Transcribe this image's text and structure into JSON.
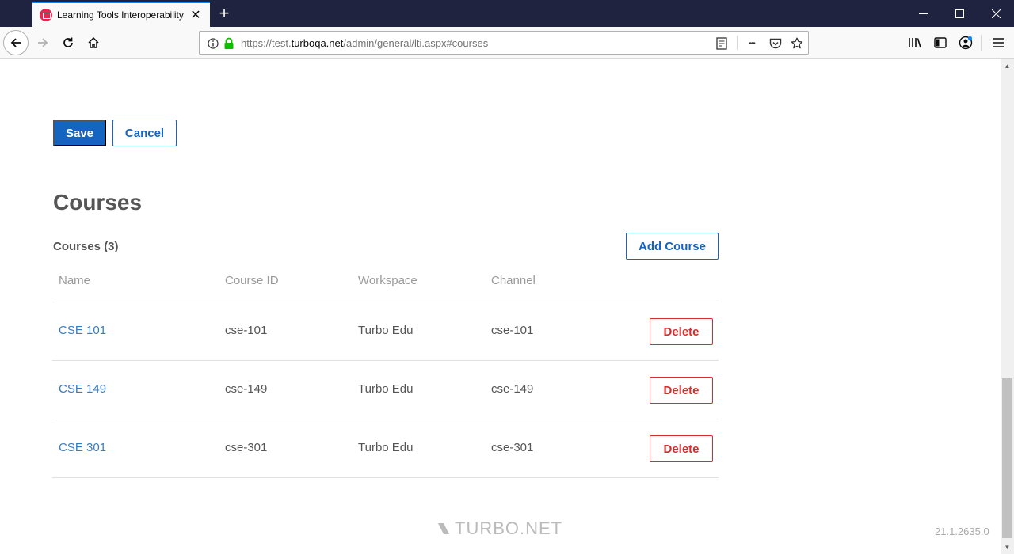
{
  "browser": {
    "tab_title": "Learning Tools Interoperability",
    "url_prefix": "https://test.",
    "url_domain": "turboqa.net",
    "url_path": "/admin/general/lti.aspx#courses",
    "icons": {
      "tab_favicon": "turbo-favicon",
      "tab_close": "close-icon",
      "new_tab": "plus-icon",
      "back": "back-arrow-icon",
      "forward": "forward-arrow-icon",
      "reload": "reload-icon",
      "home": "home-icon",
      "info": "info-icon",
      "lock": "lock-icon",
      "reader": "reader-view-icon",
      "more": "page-actions-icon",
      "pocket": "pocket-icon",
      "bookmark": "star-icon",
      "library": "library-icon",
      "sidebar": "sidebar-icon",
      "account": "account-icon",
      "menu": "hamburger-menu-icon"
    },
    "glyphs": {
      "tab_close": "✕",
      "new_tab": "+",
      "minimize": "—",
      "close": "✕",
      "more": "•••",
      "menu": "☰",
      "star": "☆",
      "scroll_up": "▲",
      "scroll_down": "▼"
    }
  },
  "form_actions": {
    "save_label": "Save",
    "cancel_label": "Cancel"
  },
  "courses": {
    "heading": "Courses",
    "count_label": "Courses (3)",
    "add_label": "Add Course",
    "columns": [
      "Name",
      "Course ID",
      "Workspace",
      "Channel"
    ],
    "rows": [
      {
        "name": "CSE 101",
        "course_id": "cse-101",
        "workspace": "Turbo Edu",
        "channel": "cse-101",
        "action": "Delete"
      },
      {
        "name": "CSE 149",
        "course_id": "cse-149",
        "workspace": "Turbo Edu",
        "channel": "cse-149",
        "action": "Delete"
      },
      {
        "name": "CSE 301",
        "course_id": "cse-301",
        "workspace": "Turbo Edu",
        "channel": "cse-301",
        "action": "Delete"
      }
    ]
  },
  "footer": {
    "logo_text": "TURBO.NET",
    "version": "21.1.2635.0"
  }
}
